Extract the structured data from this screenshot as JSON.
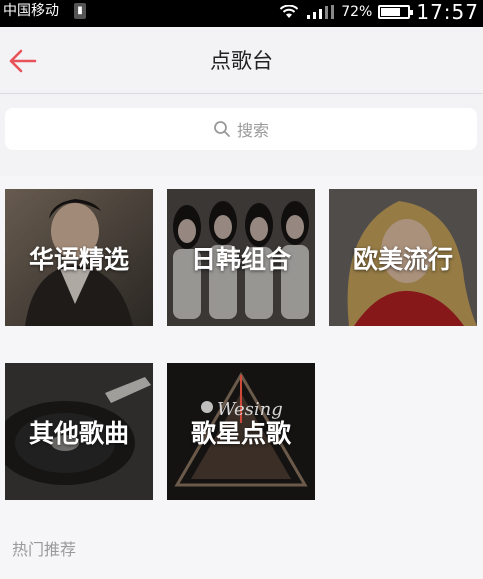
{
  "status_bar": {
    "carrier": "中国移动",
    "battery_percent": "72%",
    "battery_level": 0.72,
    "time": "17:57",
    "icons": [
      "usb-icon",
      "wifi-icon",
      "signal-icon",
      "battery-icon"
    ]
  },
  "header": {
    "title": "点歌台",
    "back_icon": "arrow-left-icon",
    "accent_color": "#e8525a"
  },
  "search": {
    "placeholder": "搜索",
    "icon": "search-icon"
  },
  "categories": [
    {
      "label": "华语精选"
    },
    {
      "label": "日韩组合"
    },
    {
      "label": "欧美流行"
    },
    {
      "label": "其他歌曲"
    },
    {
      "label": "歌星点歌",
      "logo_text": "Wesing"
    }
  ],
  "section": {
    "title": "热门推荐"
  }
}
